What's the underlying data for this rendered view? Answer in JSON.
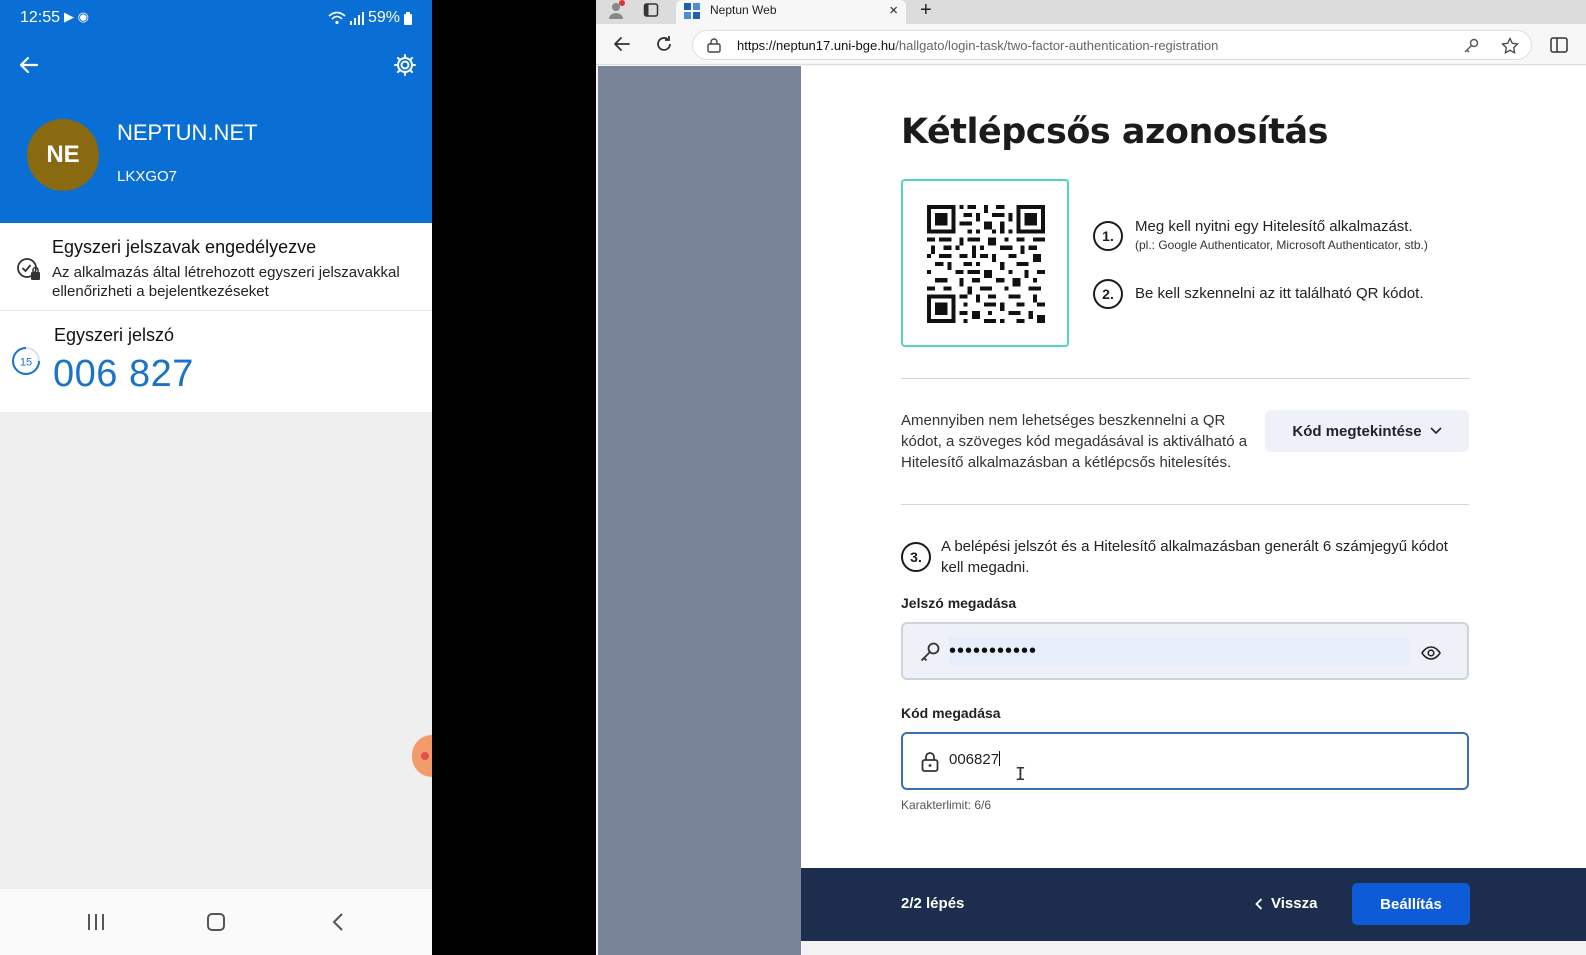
{
  "phone": {
    "status": {
      "time": "12:55",
      "left_icons": "▶ ◉",
      "battery": "59%"
    },
    "account": {
      "initials": "NE",
      "name": "NEPTUN.NET",
      "id": "LKXGO7"
    },
    "otp_enabled": {
      "title": "Egyszeri jelszavak engedélyezve",
      "description": "Az alkalmazás által létrehozott egyszeri jelszavakkal ellenőrizheti a bejelentkezéseket"
    },
    "otp": {
      "label": "Egyszeri jelszó",
      "code": "006 827",
      "seconds_left": "15"
    },
    "colors": {
      "header": "#0a6fd4",
      "avatar": "#8a6a10",
      "code": "#1a73c8"
    }
  },
  "browser": {
    "tab_title": "Neptun Web",
    "new_tab": "+",
    "close": "×",
    "url_host": "https://neptun17.uni-bge.hu",
    "url_path": "/hallgato/login-task/two-factor-authentication-registration"
  },
  "page": {
    "title": "Kétlépcsős azonosítás",
    "steps": {
      "s1_num": "1.",
      "s1_text": "Meg kell nyitni egy Hitelesítő alkalmazást.",
      "s1_hint": "(pl.: Google Authenticator, Microsoft Authenticator, stb.)",
      "s2_num": "2.",
      "s2_text": "Be kell szkennelni az itt található QR kódot.",
      "s3_num": "3.",
      "s3_text": "A belépési jelszót és a Hitelesítő alkalmazásban generált 6 számjegyű kódot kell megadni."
    },
    "alt_text": "Amennyiben nem lehetséges beszkennelni a QR kódot, a szöveges kód megadásával is aktiválható a Hitelesítő alkalmazásban a kétlépcsős hitelesítés.",
    "view_code_label": "Kód megtekintése",
    "password": {
      "label": "Jelszó megadása",
      "value": "•••••••••••"
    },
    "code": {
      "label": "Kód megadása",
      "value": "006827",
      "char_limit": "Karakterlimit: 6/6"
    },
    "footer": {
      "steps": "2/2  lépés",
      "back": "Vissza",
      "submit": "Beállítás"
    },
    "colors": {
      "accent": "#0e5bd8",
      "qr_border": "#52d6b8",
      "footer": "#1c2d4d"
    }
  }
}
